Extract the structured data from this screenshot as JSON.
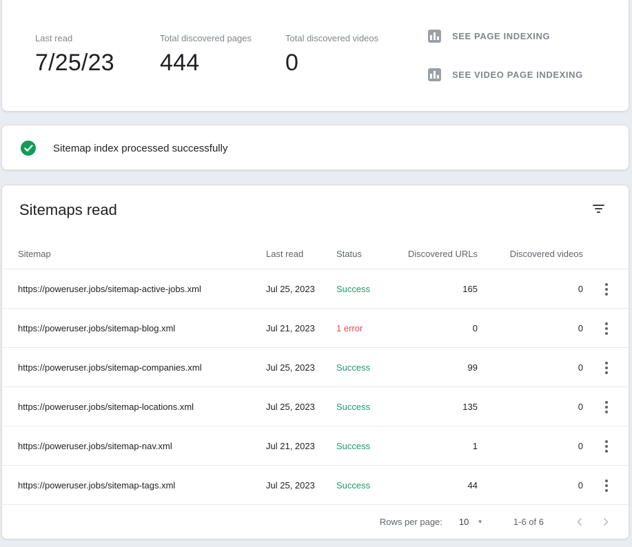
{
  "summary": {
    "stats": [
      {
        "label": "Last read",
        "value": "7/25/23"
      },
      {
        "label": "Total discovered pages",
        "value": "444"
      },
      {
        "label": "Total discovered videos",
        "value": "0"
      }
    ],
    "actions": [
      {
        "label": "SEE PAGE INDEXING",
        "icon": "bar-chart-icon"
      },
      {
        "label": "SEE VIDEO PAGE INDEXING",
        "icon": "bar-chart-icon"
      }
    ]
  },
  "banner": {
    "message": "Sitemap index processed successfully",
    "icon": "check-circle-icon"
  },
  "table": {
    "title": "Sitemaps read",
    "filter_icon": "filter-list-icon",
    "columns": [
      "Sitemap",
      "Last read",
      "Status",
      "Discovered URLs",
      "Discovered videos"
    ],
    "rows": [
      {
        "sitemap": "https://poweruser.jobs/sitemap-active-jobs.xml",
        "last_read": "Jul 25, 2023",
        "status": "Success",
        "status_type": "success",
        "discovered_urls": "165",
        "discovered_videos": "0"
      },
      {
        "sitemap": "https://poweruser.jobs/sitemap-blog.xml",
        "last_read": "Jul 21, 2023",
        "status": "1 error",
        "status_type": "error",
        "discovered_urls": "0",
        "discovered_videos": "0"
      },
      {
        "sitemap": "https://poweruser.jobs/sitemap-companies.xml",
        "last_read": "Jul 25, 2023",
        "status": "Success",
        "status_type": "success",
        "discovered_urls": "99",
        "discovered_videos": "0"
      },
      {
        "sitemap": "https://poweruser.jobs/sitemap-locations.xml",
        "last_read": "Jul 25, 2023",
        "status": "Success",
        "status_type": "success",
        "discovered_urls": "135",
        "discovered_videos": "0"
      },
      {
        "sitemap": "https://poweruser.jobs/sitemap-nav.xml",
        "last_read": "Jul 21, 2023",
        "status": "Success",
        "status_type": "success",
        "discovered_urls": "1",
        "discovered_videos": "0"
      },
      {
        "sitemap": "https://poweruser.jobs/sitemap-tags.xml",
        "last_read": "Jul 25, 2023",
        "status": "Success",
        "status_type": "success",
        "discovered_urls": "44",
        "discovered_videos": "0"
      }
    ],
    "pagination": {
      "rows_per_page_label": "Rows per page:",
      "rows_per_page_value": "10",
      "dropdown_icon": "▾",
      "range": "1-6 of 6",
      "prev_icon": "chevron-left-icon",
      "next_icon": "chevron-right-icon"
    }
  },
  "colors": {
    "success_text": "#1a9b68",
    "error_text": "#e8435a",
    "check_circle": "#0f9d58",
    "card_border": "#dadce0",
    "background": "#e9ecf1",
    "text_primary": "#202124",
    "text_secondary": "#5f6368",
    "text_muted": "#80868b",
    "icon_gray": "#9aa0a6"
  }
}
